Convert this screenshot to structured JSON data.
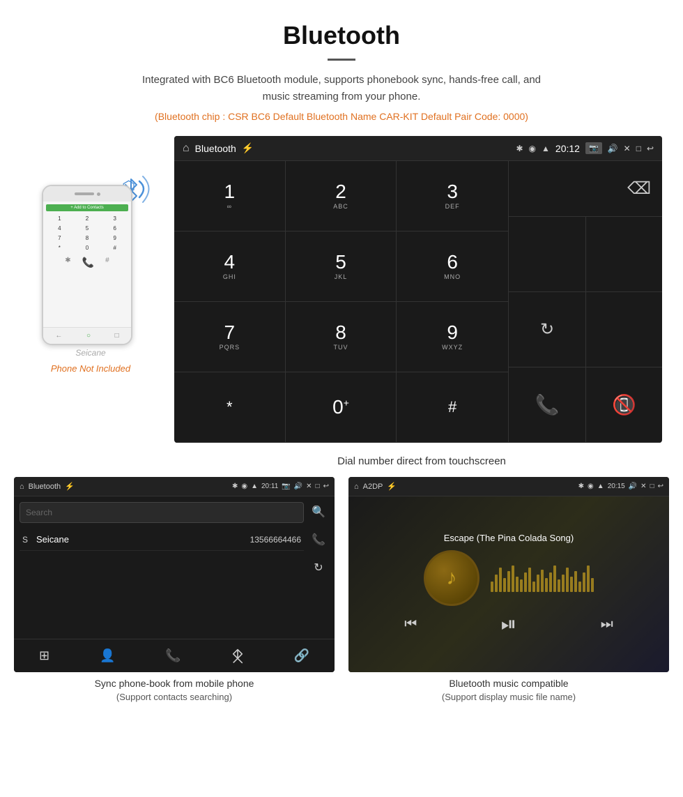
{
  "header": {
    "title": "Bluetooth",
    "description": "Integrated with BC6 Bluetooth module, supports phonebook sync, hands-free call, and music streaming from your phone.",
    "specs": "(Bluetooth chip : CSR BC6    Default Bluetooth Name CAR-KIT    Default Pair Code: 0000)"
  },
  "phone_label": "Phone Not Included",
  "car_screen": {
    "status_bar": {
      "title": "Bluetooth",
      "usb_icon": "⚡",
      "time": "20:12",
      "icons": [
        "🔷",
        "📍",
        "📶"
      ]
    },
    "dial_keys": [
      {
        "num": "1",
        "letters": "∞"
      },
      {
        "num": "2",
        "letters": "ABC"
      },
      {
        "num": "3",
        "letters": "DEF"
      },
      {
        "num": "4",
        "letters": "GHI"
      },
      {
        "num": "5",
        "letters": "JKL"
      },
      {
        "num": "6",
        "letters": "MNO"
      },
      {
        "num": "7",
        "letters": "PQRS"
      },
      {
        "num": "8",
        "letters": "TUV"
      },
      {
        "num": "9",
        "letters": "WXYZ"
      },
      {
        "num": "*",
        "letters": ""
      },
      {
        "num": "0",
        "letters": "+"
      },
      {
        "num": "#",
        "letters": ""
      }
    ],
    "bottom_icons": [
      "⊞",
      "👤",
      "📞",
      "✱",
      "🔗"
    ]
  },
  "dial_caption": "Dial number direct from touchscreen",
  "phonebook_screen": {
    "title": "Bluetooth",
    "time": "20:11",
    "search_placeholder": "Search",
    "contacts": [
      {
        "letter": "S",
        "name": "Seicane",
        "number": "13566664466"
      }
    ],
    "bottom_caption": "Sync phone-book from mobile phone",
    "bottom_caption_sub": "(Support contacts searching)"
  },
  "music_screen": {
    "title": "A2DP",
    "time": "20:15",
    "song_title": "Escape (The Pina Colada Song)",
    "bottom_caption": "Bluetooth music compatible",
    "bottom_caption_sub": "(Support display music file name)"
  },
  "seicane_watermark": "Seicane",
  "music_bars_heights": [
    15,
    25,
    35,
    20,
    30,
    38,
    22,
    18,
    28,
    35,
    15,
    25,
    32,
    20,
    28,
    38,
    18,
    25,
    35,
    22,
    30,
    15,
    28,
    38,
    20
  ]
}
